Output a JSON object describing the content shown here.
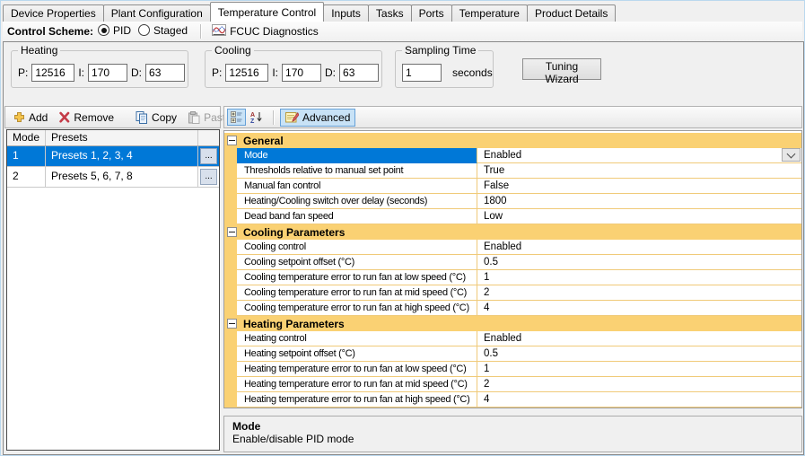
{
  "tabs": {
    "items": [
      "Device Properties",
      "Plant Configuration",
      "Temperature Control",
      "Inputs",
      "Tasks",
      "Ports",
      "Temperature",
      "Product Details"
    ],
    "active_index": 2
  },
  "control_scheme": {
    "label": "Control Scheme:",
    "options": [
      {
        "label": "PID",
        "selected": true
      },
      {
        "label": "Staged",
        "selected": false
      }
    ],
    "diagnostics": {
      "icon": "diagnostics-chart-icon",
      "label": "FCUC Diagnostics"
    }
  },
  "pid": {
    "p_label": "P:",
    "i_label": "I:",
    "d_label": "D:",
    "heating": {
      "title": "Heating",
      "p": "12516",
      "i": "170",
      "d": "63"
    },
    "cooling": {
      "title": "Cooling",
      "p": "12516",
      "i": "170",
      "d": "63"
    },
    "sampling": {
      "title": "Sampling Time",
      "value": "1",
      "unit": "seconds"
    },
    "tuning_button": "Tuning Wizard"
  },
  "modes_panel": {
    "toolbar": [
      {
        "icon": "add-icon",
        "label": "Add",
        "name": "add-button",
        "enabled": true
      },
      {
        "icon": "remove-icon",
        "label": "Remove",
        "name": "remove-button",
        "enabled": true
      },
      {
        "sep": true
      },
      {
        "icon": "copy-icon",
        "label": "Copy",
        "name": "copy-button",
        "enabled": true
      },
      {
        "icon": "paste-icon",
        "label": "Paste",
        "name": "paste-button",
        "enabled": false
      }
    ],
    "columns": [
      "Mode",
      "Presets"
    ],
    "ellipsis": "...",
    "rows": [
      {
        "mode": "1",
        "presets": "Presets 1, 2, 3, 4",
        "selected": true
      },
      {
        "mode": "2",
        "presets": "Presets 5, 6, 7, 8",
        "selected": false
      }
    ]
  },
  "property_grid": {
    "toolbar": [
      {
        "icon": "categorized-icon",
        "name": "categorized-button",
        "toggled": true
      },
      {
        "icon": "sort-alphabetical-icon",
        "name": "sort-alphabetical-button",
        "toggled": false
      },
      {
        "sep": true
      },
      {
        "icon": "advanced-icon",
        "name": "advanced-button",
        "label": "Advanced",
        "toggled": true
      }
    ],
    "categories": [
      {
        "name": "General",
        "rows": [
          {
            "label": "Mode",
            "value": "Enabled",
            "selected": true,
            "dropdown": true
          },
          {
            "label": "Thresholds relative to manual set point",
            "value": "True"
          },
          {
            "label": "Manual fan control",
            "value": "False"
          },
          {
            "label": "Heating/Cooling switch over delay (seconds)",
            "value": "1800"
          },
          {
            "label": "Dead band fan speed",
            "value": "Low"
          }
        ]
      },
      {
        "name": "Cooling Parameters",
        "rows": [
          {
            "label": "Cooling control",
            "value": "Enabled"
          },
          {
            "label": "Cooling setpoint offset (°C)",
            "value": "0.5"
          },
          {
            "label": "Cooling temperature error to run fan at low speed (°C)",
            "value": "1"
          },
          {
            "label": "Cooling temperature error to run fan at mid speed (°C)",
            "value": "2"
          },
          {
            "label": "Cooling temperature error to run fan at high speed (°C)",
            "value": "4"
          }
        ]
      },
      {
        "name": "Heating Parameters",
        "rows": [
          {
            "label": "Heating control",
            "value": "Enabled"
          },
          {
            "label": "Heating setpoint offset (°C)",
            "value": "0.5"
          },
          {
            "label": "Heating temperature error to run fan at low speed (°C)",
            "value": "1"
          },
          {
            "label": "Heating temperature error to run fan at mid speed (°C)",
            "value": "2"
          },
          {
            "label": "Heating temperature error to run fan at high speed (°C)",
            "value": "4"
          }
        ]
      }
    ],
    "help": {
      "title": "Mode",
      "description": "Enable/disable PID mode"
    }
  },
  "colors": {
    "category_gold": "#FAD173",
    "grid_line_gold": "#F0CA79",
    "selection_blue": "#0078D7",
    "toggle_blue": "#C8E2F6",
    "window_bg": "#F0F0F0"
  }
}
